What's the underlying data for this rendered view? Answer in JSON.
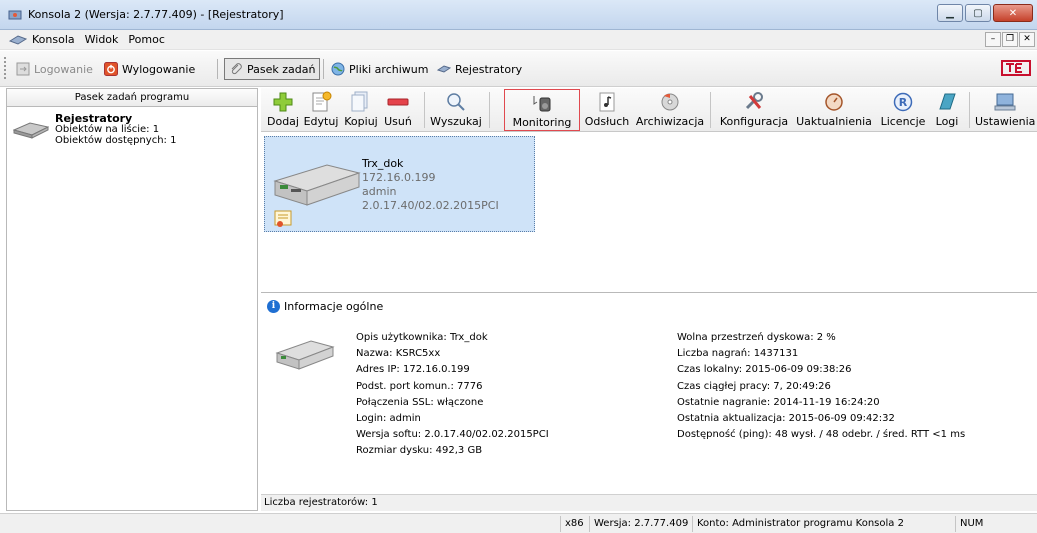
{
  "window": {
    "title": "Konsola 2 (Wersja:  2.7.77.409) - [Rejestratory]"
  },
  "menu": {
    "items": [
      "Konsola",
      "Widok",
      "Pomoc"
    ]
  },
  "toolbar_top": {
    "login": "Logowanie",
    "logout": "Wylogowanie",
    "tasks": "Pasek zadań",
    "archives": "Pliki archiwum",
    "recorders": "Rejestratory"
  },
  "left_pane": {
    "header": "Pasek zadań programu",
    "item_title": "Rejestratory",
    "item_line1": "Obiektów na liście: 1",
    "item_line2": "Obiektów dostępnych: 1"
  },
  "toolbar_main": {
    "add": "Dodaj",
    "edit": "Edytuj",
    "copy": "Kopiuj",
    "delete": "Usuń",
    "search": "Wyszukaj",
    "monitoring": "Monitoring",
    "listen": "Odsłuch",
    "archive": "Archiwizacja",
    "config": "Konfiguracja",
    "update": "Uaktualnienia",
    "licenses": "Licencje",
    "logs": "Logi",
    "settings": "Ustawienia"
  },
  "device_card": {
    "name": "Trx_dok",
    "ip": "172.16.0.199",
    "user": "admin",
    "version": "2.0.17.40/02.02.2015PCI"
  },
  "info": {
    "title": "Informacje ogólne",
    "left": [
      "Opis użytkownika: Trx_dok",
      "Nazwa: KSRC5xx",
      "Adres IP: 172.16.0.199",
      "Podst. port komun.: 7776",
      "Połączenia SSL: włączone",
      "Login: admin",
      "Wersja softu: 2.0.17.40/02.02.2015PCI",
      "Rozmiar dysku: 492,3 GB"
    ],
    "right": [
      "Wolna przestrzeń dyskowa: 2 %",
      "Liczba nagrań: 1437131",
      "Czas lokalny: 2015-06-09 09:38:26",
      "Czas ciągłej pracy: 7, 20:49:26",
      "Ostatnie nagranie: 2014-11-19 16:24:20",
      "Ostatnia aktualizacja: 2015-06-09 09:42:32",
      "Dostępność (ping): 48 wysł. / 48 odebr. / śred. RTT <1 ms"
    ]
  },
  "count_line": "Liczba rejestratorów: 1",
  "statusbar": {
    "arch": "x86",
    "version": "Wersja: 2.7.77.409",
    "account": "Konto: Administrator programu Konsola 2",
    "num": "NUM"
  }
}
